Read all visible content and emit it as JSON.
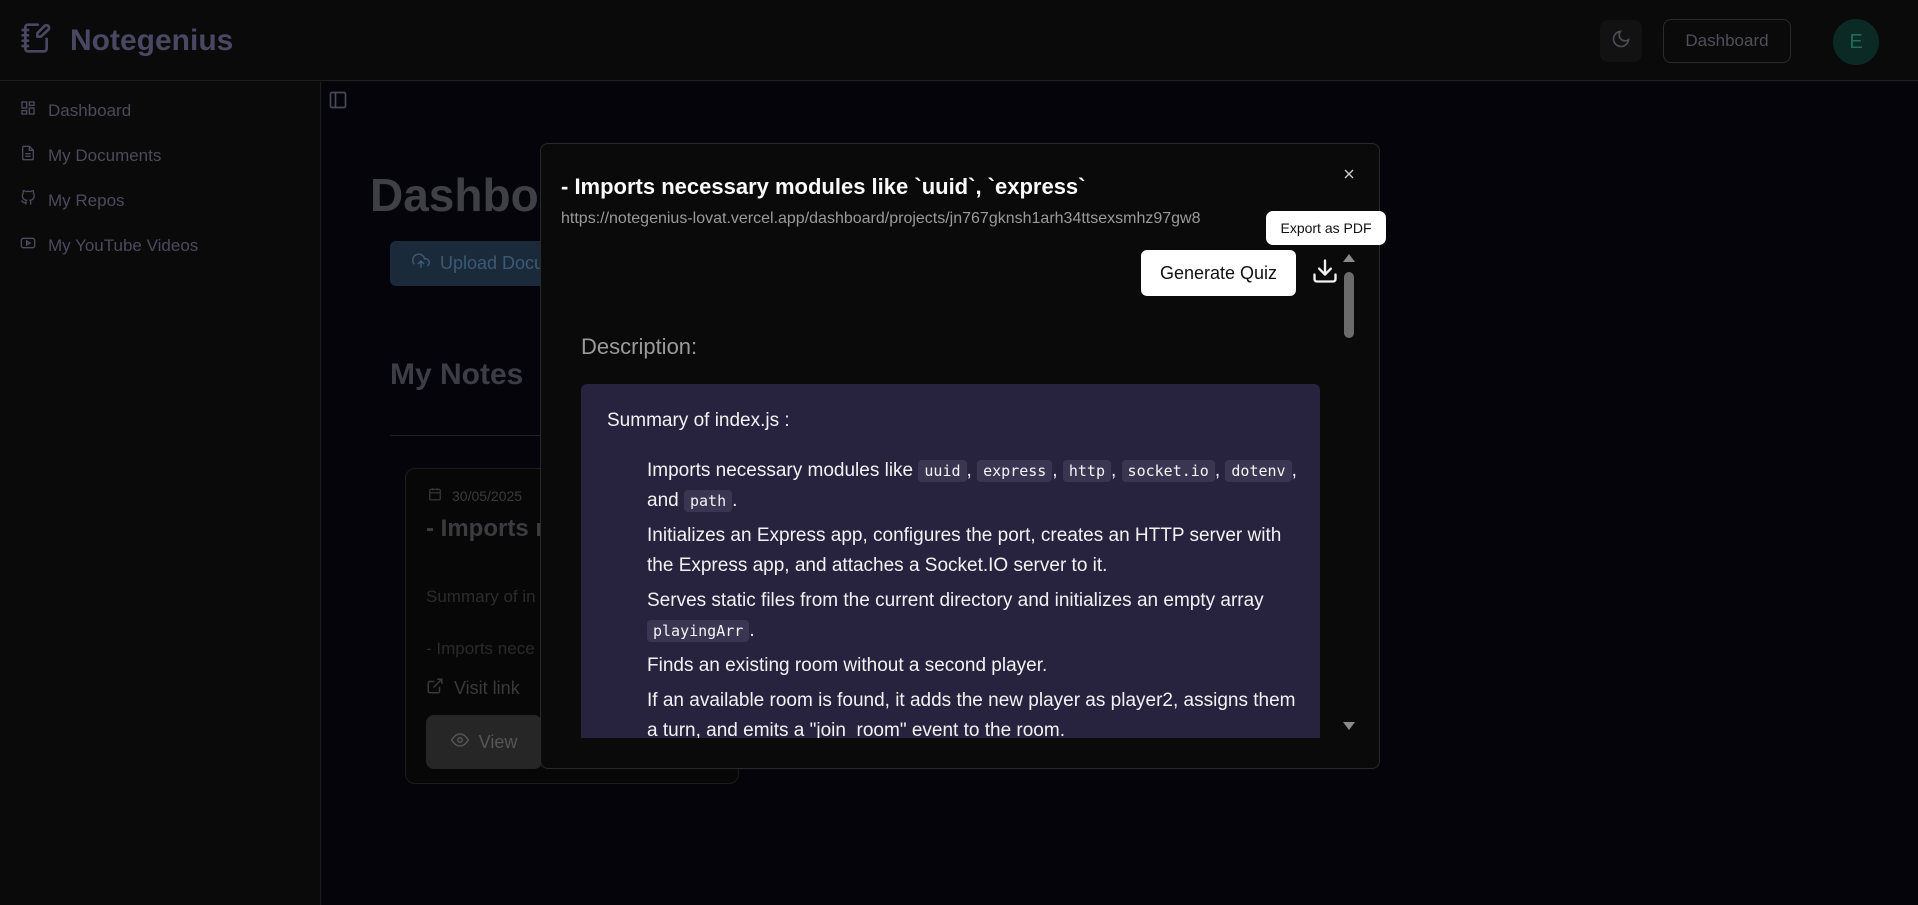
{
  "app": {
    "brand": "Notegenius",
    "header_dashboard_label": "Dashboard",
    "avatar_initial": "E"
  },
  "sidebar": {
    "items": [
      {
        "label": "Dashboard",
        "icon": "grid-icon"
      },
      {
        "label": "My Documents",
        "icon": "document-icon"
      },
      {
        "label": "My Repos",
        "icon": "github-icon"
      },
      {
        "label": "My YouTube Videos",
        "icon": "youtube-icon"
      }
    ]
  },
  "main": {
    "page_title": "Dashboa",
    "upload_label": "Upload Docu",
    "notes_title": "My Notes",
    "card": {
      "date": "30/05/2025",
      "title": "- Imports n",
      "summary": "Summary of in",
      "bullet": "- Imports nece",
      "visit_label": "Visit link",
      "view_label": "View"
    }
  },
  "modal": {
    "title": "- Imports necessary modules like `uuid`, `express`",
    "url": "https://notegenius-lovat.vercel.app/dashboard/projects/jn767gknsh1arh34ttsexsmhz97gw8",
    "tooltip": "Export as PDF",
    "quiz_label": "Generate Quiz",
    "description_label": "Description:",
    "summary_title": "Summary of index.js :",
    "bullets": {
      "b1_pre": "Imports necessary modules like",
      "b1_c1": "uuid",
      "b1_c2": "express",
      "b1_c3": "http",
      "b1_c4": "socket.io",
      "b1_c5": "dotenv",
      "b1_and": ", and",
      "b1_c6": "path",
      "b2": "Initializes an Express app, configures the port, creates an HTTP server with the Express app, and attaches a Socket.IO server to it.",
      "b3_pre": "Serves static files from the current directory and initializes an empty array",
      "b3_code": "playingArr",
      "b4": "Finds an existing room without a second player.",
      "b5": "If an available room is found, it adds the new player as player2, assigns them a turn, and emits a \"join_room\" event to the room."
    }
  },
  "colors": {
    "content_bg": "#27233f",
    "modal_bg": "#0a0a0a"
  }
}
